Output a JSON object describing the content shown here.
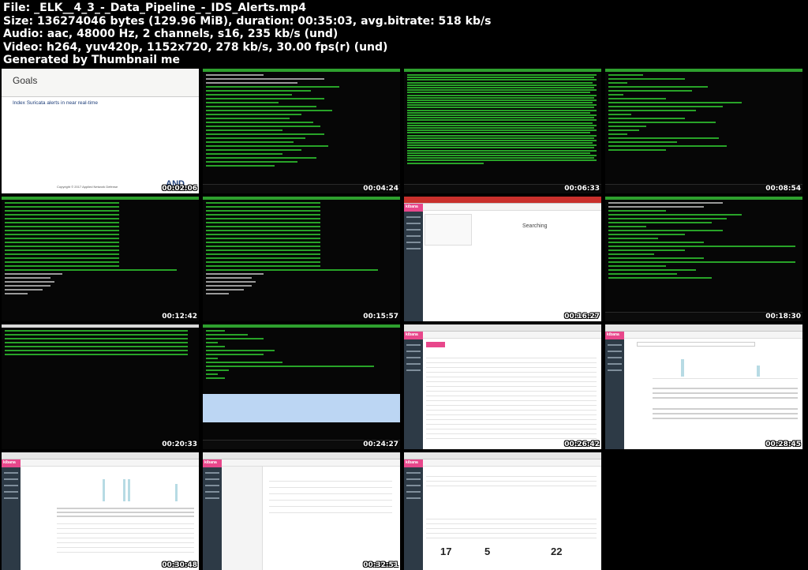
{
  "header": {
    "file_line": "File: _ELK__4_3_-_Data_Pipeline_-_IDS_Alerts.mp4",
    "size_line": "Size: 136274046 bytes (129.96 MiB), duration: 00:35:03, avg.bitrate: 518 kb/s",
    "audio_line": "Audio: aac, 48000 Hz, 2 channels, s16, 235 kb/s (und)",
    "video_line": "Video: h264, yuv420p, 1152x720, 278 kb/s, 30.00 fps(r) (und)",
    "generated_line": "Generated by Thumbnail me"
  },
  "slide": {
    "title": "Goals",
    "bullet": "Index Suricata alerts in near real-time",
    "footer": "Copyright © 2017 Applied Network Defense",
    "logo": "AND"
  },
  "kibana": {
    "brand": "kibana",
    "searching": "Searching",
    "tile_1_value": "17",
    "tile_2_value": "5",
    "tile_3_value": "22"
  },
  "timestamps": [
    "00:02:06",
    "00:04:24",
    "00:06:33",
    "00:08:54",
    "00:12:42",
    "00:15:57",
    "00:16:27",
    "00:18:30",
    "00:20:33",
    "00:24:27",
    "00:26:42",
    "00:28:45",
    "00:30:48",
    "00:32:51"
  ],
  "colors": {
    "terminal_green": "#2fc02f",
    "kibana_pink": "#e8478b",
    "kibana_sidebar": "#2d3a46"
  }
}
